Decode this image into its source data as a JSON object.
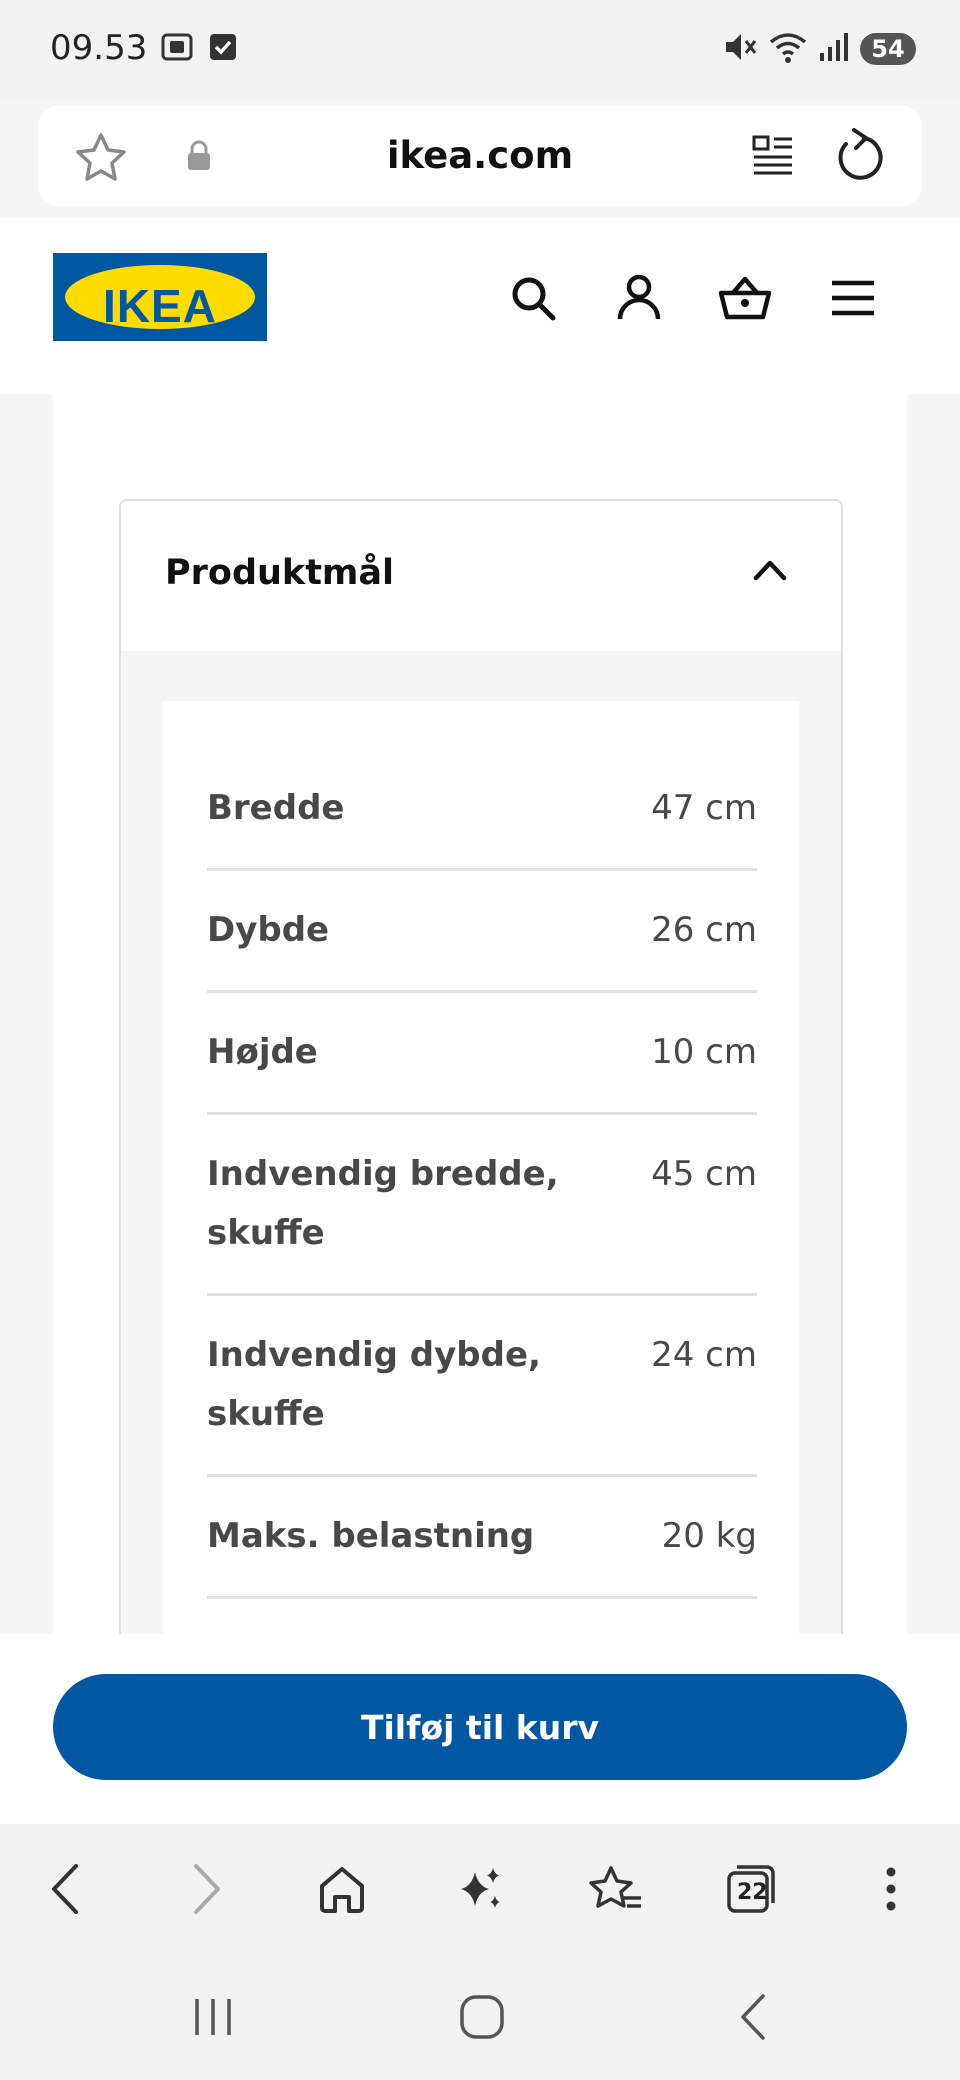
{
  "status_bar": {
    "time": "09.53",
    "battery": "54"
  },
  "browser": {
    "url": "ikea.com",
    "tab_count": "22"
  },
  "header": {
    "logo_text": "IKEA",
    "brand_colors": {
      "blue": "#0058a3",
      "yellow": "#ffdb00"
    }
  },
  "accordion": {
    "title": "Produktmål",
    "expanded": true
  },
  "dimensions": [
    {
      "label": "Bredde",
      "value": "47 cm"
    },
    {
      "label": "Dybde",
      "value": "26 cm"
    },
    {
      "label": "Højde",
      "value": "10 cm"
    },
    {
      "label": "Indvendig bredde, skuffe",
      "value": "45 cm"
    },
    {
      "label": "Indvendig dybde, skuffe",
      "value": "24 cm"
    },
    {
      "label": "Maks. belastning",
      "value": "20 kg"
    }
  ],
  "cta": {
    "add_to_cart_label": "Tilføj til kurv",
    "color": "#0058a3"
  }
}
